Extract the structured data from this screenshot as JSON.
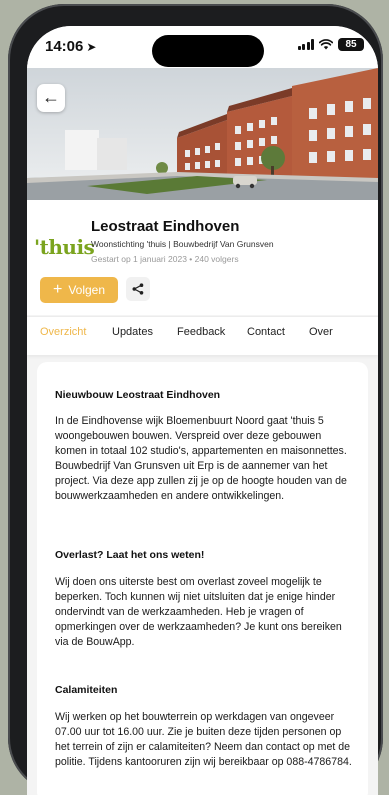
{
  "status_bar": {
    "time": "14:06",
    "location_arrow": "➤",
    "battery": "85"
  },
  "header": {
    "back_icon": "←",
    "project_title": "Leostraat Eindhoven",
    "organization": "Woonstichting 'thuis | Bouwbedrijf Van Grunsven",
    "meta": "Gestart op 1 januari 2023  •  240 volgers",
    "logo_text": "'thuis"
  },
  "actions": {
    "follow_icon": "+",
    "follow_label": "Volgen"
  },
  "tabs": [
    {
      "label": "Overzicht",
      "active": true
    },
    {
      "label": "Updates",
      "active": false
    },
    {
      "label": "Feedback",
      "active": false
    },
    {
      "label": "Contact",
      "active": false
    },
    {
      "label": "Over",
      "active": false
    }
  ],
  "sections": [
    {
      "title": "Nieuwbouw Leostraat Eindhoven",
      "body": "In de Eindhovense wijk Bloemenbuurt Noord gaat 'thuis 5 woongebouwen bouwen. Verspreid over deze gebouwen komen in totaal 102 studio's, appartementen en maisonnettes. Bouwbedrijf Van Grunsven uit Erp is de aannemer van het project. Via deze app zullen zij je op de hoogte houden van de bouwwerkzaamheden en andere ontwikkelingen."
    },
    {
      "title": "Overlast? Laat het ons weten!",
      "body": "Wij doen ons uiterste best om overlast zoveel mogelijk te beperken. Toch kunnen wij niet uitsluiten dat je enige hinder ondervindt van de werkzaamheden. Heb je vragen of opmerkingen over de werkzaamheden? Je kunt ons bereiken via de BouwApp."
    },
    {
      "title": "Calamiteiten",
      "body": "Wij werken op het bouwterrein op werkdagen van ongeveer 07.00 uur tot 16.00 uur. Zie je buiten deze tijden personen op het terrein of zijn er calamiteiten? Neem dan contact op met de politie. Tijdens kantooruren zijn wij bereikbaar op 088-4786784."
    }
  ],
  "colors": {
    "accent": "#efb74a",
    "logo_green": "#7ba41f",
    "brick": "#b45a3c"
  }
}
